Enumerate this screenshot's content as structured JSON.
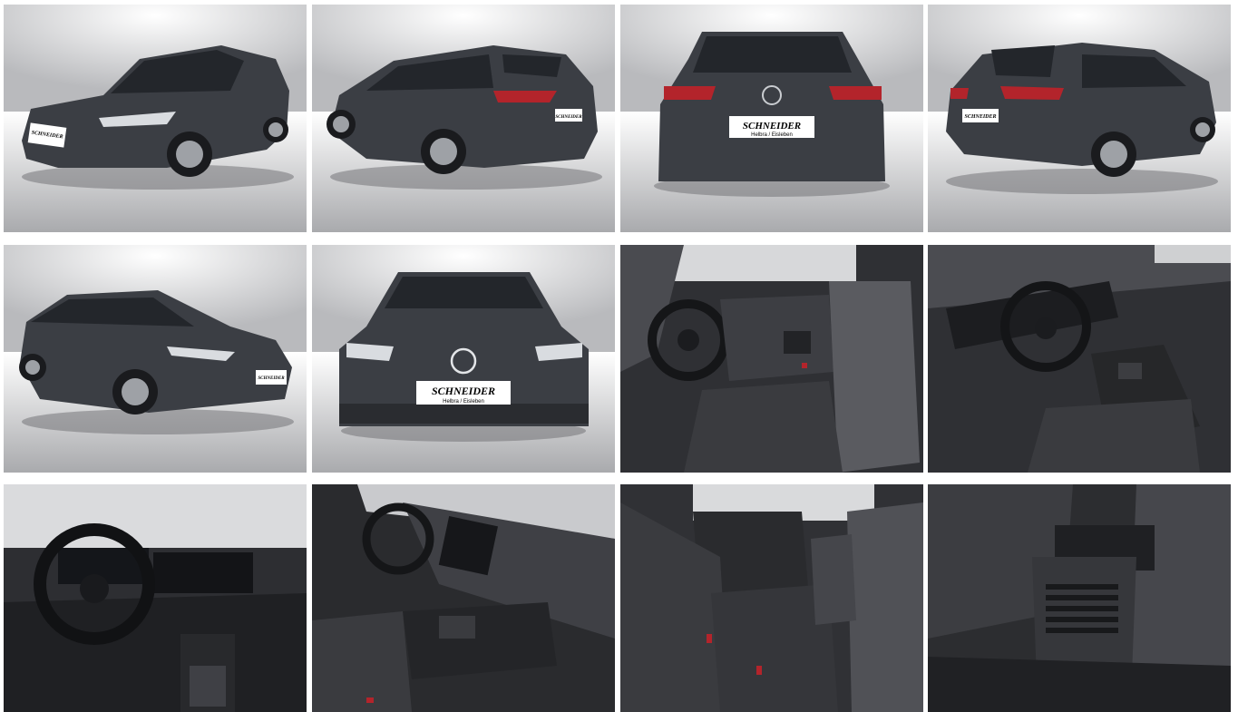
{
  "gallery": {
    "photos": [
      {
        "subject": "exterior-front-left-three-quarter",
        "plate": "SCHNEIDER",
        "plate_sub": "Helbra / Eisleben"
      },
      {
        "subject": "exterior-rear-left-three-quarter",
        "plate": "SCHNEIDER",
        "plate_sub": "Helbra / Eisleben"
      },
      {
        "subject": "exterior-rear",
        "plate": "SCHNEIDER",
        "plate_sub": "Helbra / Eisleben"
      },
      {
        "subject": "exterior-rear-right-three-quarter",
        "plate": "SCHNEIDER",
        "plate_sub": "Helbra / Eisleben"
      },
      {
        "subject": "exterior-front-right-three-quarter",
        "plate": "SCHNEIDER",
        "plate_sub": "Helbra / Eisleben"
      },
      {
        "subject": "exterior-front",
        "plate": "SCHNEIDER",
        "plate_sub": "Helbra / Eisleben"
      },
      {
        "subject": "interior-driver-seat",
        "plate": "",
        "plate_sub": ""
      },
      {
        "subject": "interior-cockpit-from-door",
        "plate": "",
        "plate_sub": ""
      },
      {
        "subject": "interior-dashboard",
        "plate": "",
        "plate_sub": ""
      },
      {
        "subject": "interior-center-console",
        "plate": "",
        "plate_sub": ""
      },
      {
        "subject": "interior-rear-seats",
        "plate": "",
        "plate_sub": ""
      },
      {
        "subject": "interior-rear-air-vents",
        "plate": "",
        "plate_sub": ""
      }
    ],
    "colors": {
      "studio_top": "#cfd0d2",
      "studio_floor": "#f4f4f4",
      "car_body": "#3b3e44",
      "glass": "#23262b",
      "tail_light": "#b3242b",
      "interior": "#2a2b2e",
      "seat_fabric": "#3a3b3f"
    }
  }
}
